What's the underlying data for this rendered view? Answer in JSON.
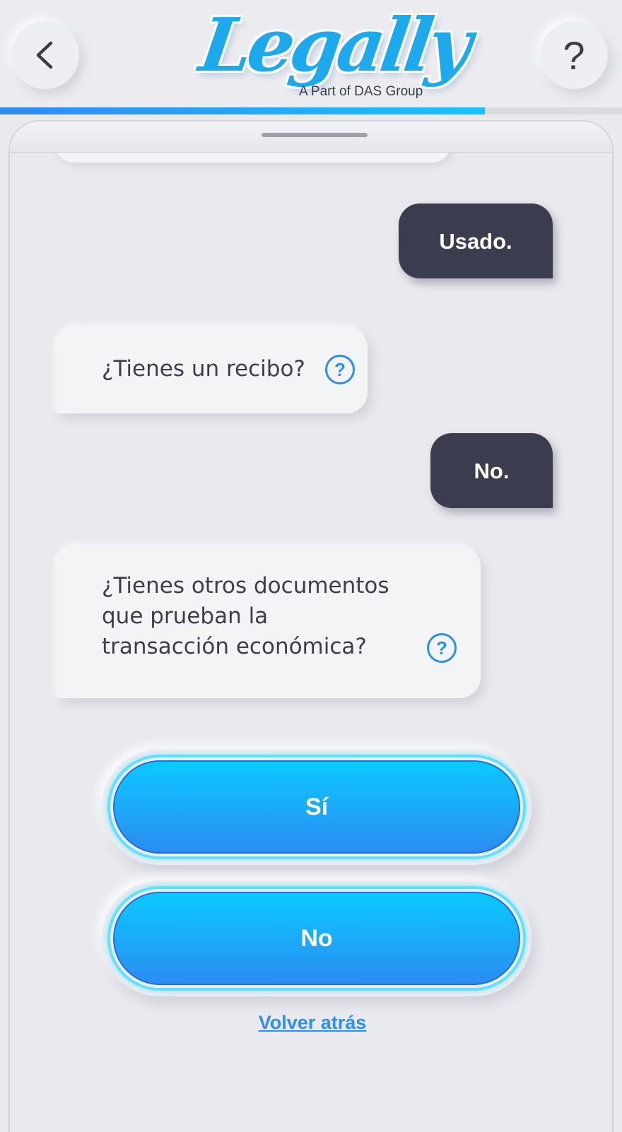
{
  "header": {
    "logo_text": "Legally",
    "logo_subtitle": "A Part of DAS Group",
    "help_symbol": "?",
    "progress_fraction": 0.78
  },
  "icons": {
    "back": "chevron-left-icon",
    "help": "question-mark-icon",
    "info": "question-circle-icon"
  },
  "colors": {
    "accent": "#2d8ef0",
    "user_bubble": "#3b3c4d",
    "button_gradient_top": "#0bc9ff",
    "button_gradient_bottom": "#2b8cf2"
  },
  "chat": {
    "messages": [
      {
        "role": "user",
        "text": "Usado."
      },
      {
        "role": "bot",
        "text": "¿Tienes un recibo?"
      },
      {
        "role": "user",
        "text": "No."
      },
      {
        "role": "bot",
        "text": "¿Tienes otros documentos que prueban la transacción económica?"
      }
    ]
  },
  "answers": {
    "yes_label": "Sí",
    "no_label": "No",
    "back_link": "Volver atrás"
  }
}
